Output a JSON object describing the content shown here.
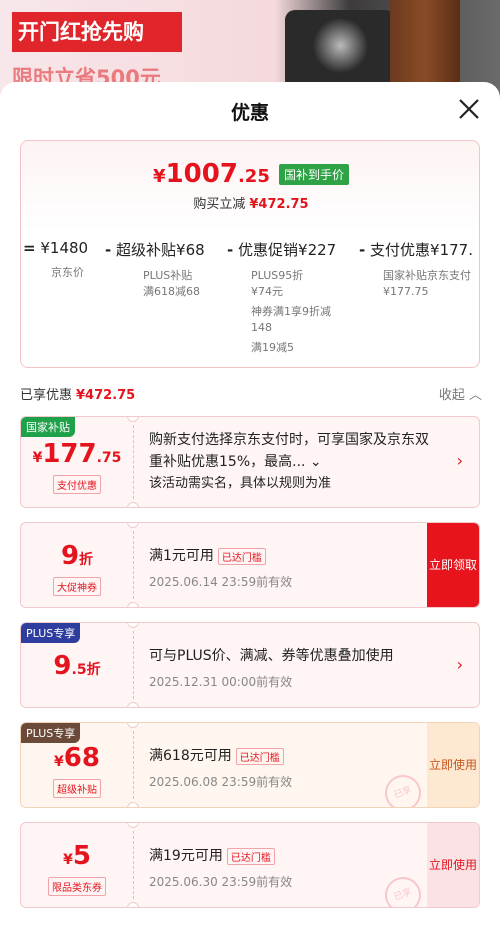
{
  "background": {
    "promo_title": "开门红抢先购",
    "promo_sub": "限时立省500元"
  },
  "sheet": {
    "title": "优惠"
  },
  "summary": {
    "final_price_int": "1007",
    "final_price_dec": ".25",
    "currency": "¥",
    "final_tag": "国补到手价",
    "bought_label": "购买立减",
    "bought_amount": "¥472.75",
    "items": [
      {
        "op": "=",
        "main_label": "",
        "main_value": "¥1480",
        "sub": [
          "京东价"
        ]
      },
      {
        "op": "-",
        "main_label": "超级补贴",
        "main_value": "¥68",
        "sub": [
          "PLUS补贴",
          "满618减68"
        ]
      },
      {
        "op": "-",
        "main_label": "优惠促销",
        "main_value": "¥227",
        "sub": [
          "PLUS95折",
          "¥74元",
          "神券满1享9折减",
          "148",
          "满19减5"
        ]
      },
      {
        "op": "-",
        "main_label": "支付优惠",
        "main_value": "¥177.",
        "sub": [
          "国家补贴京东支付",
          "¥177.75"
        ]
      }
    ]
  },
  "enjoyed": {
    "label": "已享优惠",
    "amount": "¥472.75",
    "collapse_label": "收起"
  },
  "coupons": [
    {
      "corner": "国家补贴",
      "corner_color": "#1fa14a",
      "value_int": "177",
      "value_dec": ".75",
      "value_prefix": "¥",
      "label": "支付优惠",
      "text1": "购新支付选择京东支付时，可享国家及京东双重补贴优惠15%，最高...",
      "text2": "该活动需实名，具体以规则为准"
    },
    {
      "value_int": "9",
      "value_suffix": "折",
      "label": "大促神券",
      "text1": "满1元可用",
      "gate": "已达门槛",
      "text2": "2025.06.14 23:59前有效",
      "action": "立即领取"
    },
    {
      "corner": "PLUS专享",
      "corner_color": "#2f3e9e",
      "value_int": "9",
      "value_dec": ".5",
      "value_suffix": "折",
      "text1": "可与PLUS价、满减、券等优惠叠加使用",
      "text2": "2025.12.31 00:00前有效"
    },
    {
      "corner": "PLUS专享",
      "corner_color": "#6b4a3a",
      "value_int": "68",
      "value_prefix": "¥",
      "label": "超级补贴",
      "text1": "满618元可用",
      "gate": "已达门槛",
      "text2": "2025.06.08 23:59前有效",
      "action": "立即使用",
      "stamp": "已享"
    },
    {
      "value_int": "5",
      "value_prefix": "¥",
      "label": "限品类东券",
      "text1": "满19元可用",
      "gate": "已达门槛",
      "text2": "2025.06.30 23:59前有效",
      "action": "立即使用",
      "stamp": "已享"
    }
  ],
  "colors": {
    "accent_red": "#e4141e",
    "green_tag": "#2ea245"
  }
}
